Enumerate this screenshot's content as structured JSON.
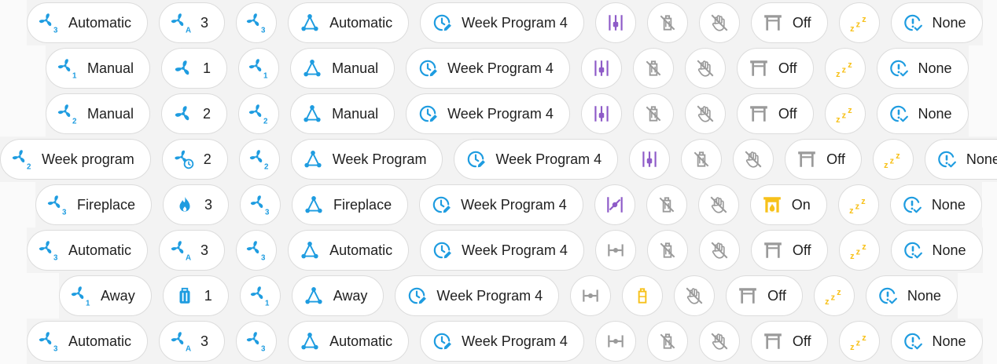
{
  "colors": {
    "blue": "#1e9ce0",
    "purple": "#8e5bc8",
    "yellow": "#f7c11a",
    "gray": "#9a9a9a",
    "text": "#212121"
  },
  "rows": [
    {
      "chips": [
        {
          "icon": "fan-speed-3-icon",
          "color": "blue",
          "label": "Automatic"
        },
        {
          "icon": "fan-auto-icon",
          "color": "blue",
          "label": "3"
        },
        {
          "icon": "fan-speed-3-icon",
          "color": "blue",
          "label": ""
        },
        {
          "icon": "triangle-nodes-icon",
          "color": "blue",
          "label": "Automatic"
        },
        {
          "icon": "clock-edit-icon",
          "color": "blue",
          "label": "Week Program 4"
        },
        {
          "icon": "tune-vertical-icon",
          "color": "purple",
          "label": ""
        },
        {
          "icon": "bag-off-icon",
          "color": "gray",
          "label": ""
        },
        {
          "icon": "hand-off-icon",
          "color": "gray",
          "label": ""
        },
        {
          "icon": "fireplace-off-icon",
          "color": "gray",
          "label": "Off"
        },
        {
          "icon": "sleep-zzz-icon",
          "color": "yellow",
          "label": ""
        },
        {
          "icon": "alert-check-icon",
          "color": "blue",
          "label": "None"
        }
      ]
    },
    {
      "chips": [
        {
          "icon": "fan-speed-1-icon",
          "color": "blue",
          "label": "Manual"
        },
        {
          "icon": "fan-icon",
          "color": "blue",
          "label": "1"
        },
        {
          "icon": "fan-speed-1-icon",
          "color": "blue",
          "label": ""
        },
        {
          "icon": "triangle-nodes-icon",
          "color": "blue",
          "label": "Manual"
        },
        {
          "icon": "clock-edit-icon",
          "color": "blue",
          "label": "Week Program 4"
        },
        {
          "icon": "tune-vertical-icon",
          "color": "purple",
          "label": ""
        },
        {
          "icon": "bag-off-icon",
          "color": "gray",
          "label": ""
        },
        {
          "icon": "hand-off-icon",
          "color": "gray",
          "label": ""
        },
        {
          "icon": "fireplace-off-icon",
          "color": "gray",
          "label": "Off"
        },
        {
          "icon": "sleep-zzz-icon",
          "color": "yellow",
          "label": ""
        },
        {
          "icon": "alert-check-icon",
          "color": "blue",
          "label": "None"
        }
      ]
    },
    {
      "chips": [
        {
          "icon": "fan-speed-2-icon",
          "color": "blue",
          "label": "Manual"
        },
        {
          "icon": "fan-icon",
          "color": "blue",
          "label": "2"
        },
        {
          "icon": "fan-speed-2-icon",
          "color": "blue",
          "label": ""
        },
        {
          "icon": "triangle-nodes-icon",
          "color": "blue",
          "label": "Manual"
        },
        {
          "icon": "clock-edit-icon",
          "color": "blue",
          "label": "Week Program 4"
        },
        {
          "icon": "tune-vertical-icon",
          "color": "purple",
          "label": ""
        },
        {
          "icon": "bag-off-icon",
          "color": "gray",
          "label": ""
        },
        {
          "icon": "hand-off-icon",
          "color": "gray",
          "label": ""
        },
        {
          "icon": "fireplace-off-icon",
          "color": "gray",
          "label": "Off"
        },
        {
          "icon": "sleep-zzz-icon",
          "color": "yellow",
          "label": ""
        },
        {
          "icon": "alert-check-icon",
          "color": "blue",
          "label": "None"
        }
      ]
    },
    {
      "chips": [
        {
          "icon": "fan-speed-2-icon",
          "color": "blue",
          "label": "Week program"
        },
        {
          "icon": "fan-clock-icon",
          "color": "blue",
          "label": "2"
        },
        {
          "icon": "fan-speed-2-icon",
          "color": "blue",
          "label": ""
        },
        {
          "icon": "triangle-nodes-icon",
          "color": "blue",
          "label": "Week Program"
        },
        {
          "icon": "clock-edit-icon",
          "color": "blue",
          "label": "Week Program 4"
        },
        {
          "icon": "tune-vertical-icon",
          "color": "purple",
          "label": ""
        },
        {
          "icon": "bag-off-icon",
          "color": "gray",
          "label": ""
        },
        {
          "icon": "hand-off-icon",
          "color": "gray",
          "label": ""
        },
        {
          "icon": "fireplace-off-icon",
          "color": "gray",
          "label": "Off"
        },
        {
          "icon": "sleep-zzz-icon",
          "color": "yellow",
          "label": ""
        },
        {
          "icon": "alert-check-icon",
          "color": "blue",
          "label": "None"
        }
      ]
    },
    {
      "chips": [
        {
          "icon": "fan-speed-3-icon",
          "color": "blue",
          "label": "Fireplace"
        },
        {
          "icon": "fire-icon",
          "color": "blue",
          "label": "3"
        },
        {
          "icon": "fan-speed-3-icon",
          "color": "blue",
          "label": ""
        },
        {
          "icon": "triangle-nodes-icon",
          "color": "blue",
          "label": "Fireplace"
        },
        {
          "icon": "clock-edit-icon",
          "color": "blue",
          "label": "Week Program 4"
        },
        {
          "icon": "tune-diagonal-icon",
          "color": "purple",
          "label": ""
        },
        {
          "icon": "bag-off-icon",
          "color": "gray",
          "label": ""
        },
        {
          "icon": "hand-off-icon",
          "color": "gray",
          "label": ""
        },
        {
          "icon": "fireplace-on-icon",
          "color": "yellow",
          "label": "On"
        },
        {
          "icon": "sleep-zzz-icon",
          "color": "yellow",
          "label": ""
        },
        {
          "icon": "alert-check-icon",
          "color": "blue",
          "label": "None"
        }
      ]
    },
    {
      "chips": [
        {
          "icon": "fan-speed-3-icon",
          "color": "blue",
          "label": "Automatic"
        },
        {
          "icon": "fan-auto-icon",
          "color": "blue",
          "label": "3"
        },
        {
          "icon": "fan-speed-3-icon",
          "color": "blue",
          "label": ""
        },
        {
          "icon": "triangle-nodes-icon",
          "color": "blue",
          "label": "Automatic"
        },
        {
          "icon": "clock-edit-icon",
          "color": "blue",
          "label": "Week Program 4"
        },
        {
          "icon": "tune-horizontal-icon",
          "color": "gray",
          "label": ""
        },
        {
          "icon": "bag-off-icon",
          "color": "gray",
          "label": ""
        },
        {
          "icon": "hand-off-icon",
          "color": "gray",
          "label": ""
        },
        {
          "icon": "fireplace-off-icon",
          "color": "gray",
          "label": "Off"
        },
        {
          "icon": "sleep-zzz-icon",
          "color": "yellow",
          "label": ""
        },
        {
          "icon": "alert-check-icon",
          "color": "blue",
          "label": "None"
        }
      ]
    },
    {
      "chips": [
        {
          "icon": "fan-speed-1-icon",
          "color": "blue",
          "label": "Away"
        },
        {
          "icon": "suitcase-icon",
          "color": "blue",
          "label": "1"
        },
        {
          "icon": "fan-speed-1-icon",
          "color": "blue",
          "label": ""
        },
        {
          "icon": "triangle-nodes-icon",
          "color": "blue",
          "label": "Away"
        },
        {
          "icon": "clock-edit-icon",
          "color": "blue",
          "label": "Week Program 4"
        },
        {
          "icon": "tune-horizontal-icon",
          "color": "gray",
          "label": ""
        },
        {
          "icon": "bag-icon",
          "color": "yellow",
          "label": ""
        },
        {
          "icon": "hand-off-icon",
          "color": "gray",
          "label": ""
        },
        {
          "icon": "fireplace-off-icon",
          "color": "gray",
          "label": "Off"
        },
        {
          "icon": "sleep-zzz-icon",
          "color": "yellow",
          "label": ""
        },
        {
          "icon": "alert-check-icon",
          "color": "blue",
          "label": "None"
        }
      ]
    },
    {
      "chips": [
        {
          "icon": "fan-speed-3-icon",
          "color": "blue",
          "label": "Automatic"
        },
        {
          "icon": "fan-auto-icon",
          "color": "blue",
          "label": "3"
        },
        {
          "icon": "fan-speed-3-icon",
          "color": "blue",
          "label": ""
        },
        {
          "icon": "triangle-nodes-icon",
          "color": "blue",
          "label": "Automatic"
        },
        {
          "icon": "clock-edit-icon",
          "color": "blue",
          "label": "Week Program 4"
        },
        {
          "icon": "tune-horizontal-icon",
          "color": "gray",
          "label": ""
        },
        {
          "icon": "bag-off-icon",
          "color": "gray",
          "label": ""
        },
        {
          "icon": "hand-off-icon",
          "color": "gray",
          "label": ""
        },
        {
          "icon": "fireplace-off-icon",
          "color": "gray",
          "label": "Off"
        },
        {
          "icon": "sleep-zzz-icon",
          "color": "yellow",
          "label": ""
        },
        {
          "icon": "alert-check-icon",
          "color": "blue",
          "label": "None"
        }
      ]
    }
  ]
}
